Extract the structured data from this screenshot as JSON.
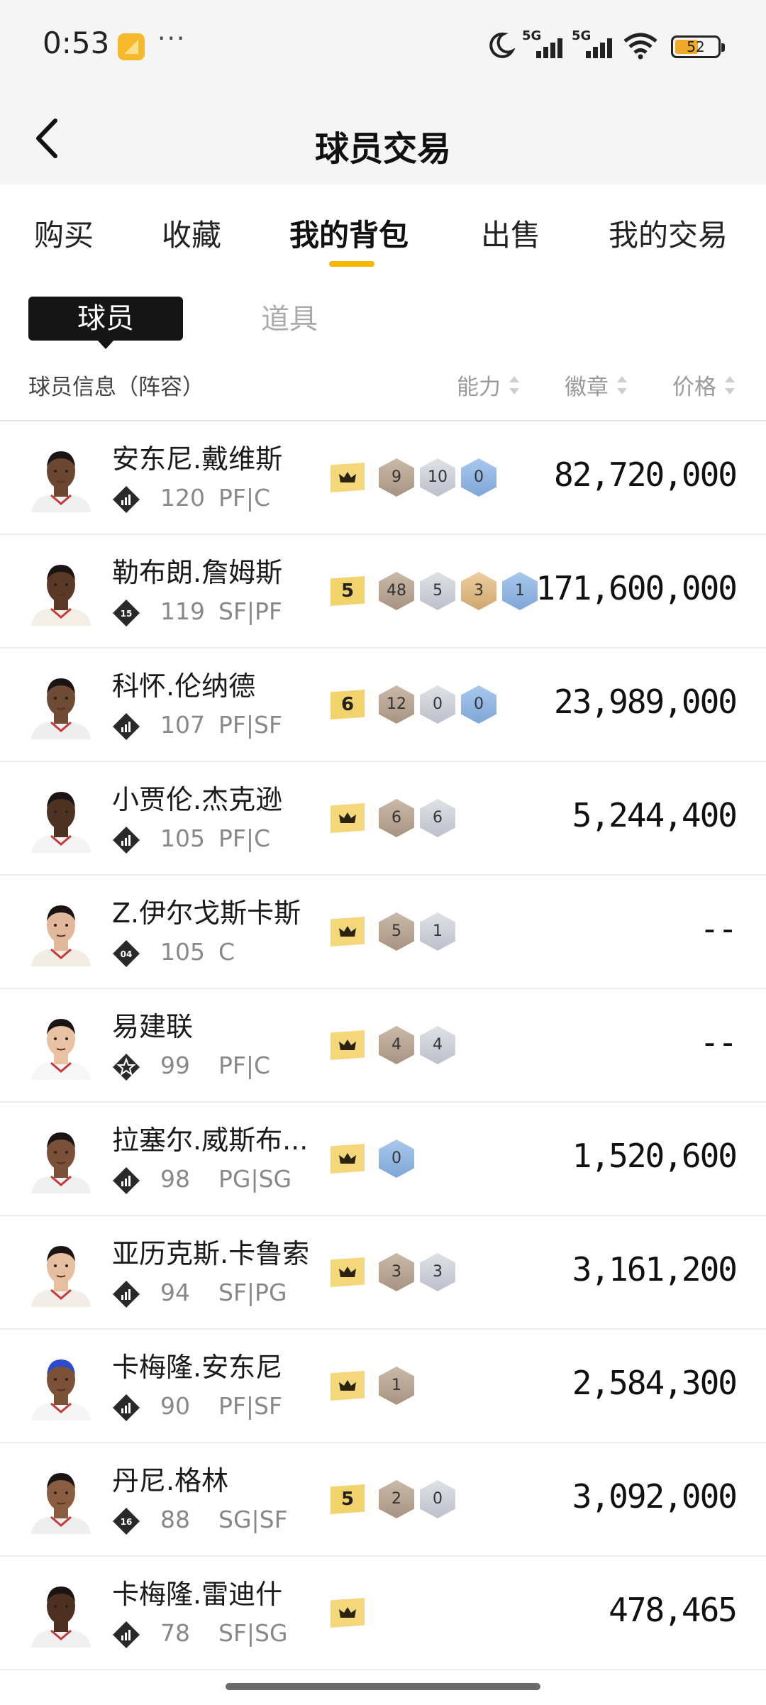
{
  "status_bar": {
    "time": "0:53",
    "more": "···",
    "battery": "52",
    "network_1": "5G",
    "network_2": "5G"
  },
  "nav": {
    "title": "球员交易"
  },
  "tabs": [
    {
      "label": "购买",
      "active": false
    },
    {
      "label": "收藏",
      "active": false
    },
    {
      "label": "我的背包",
      "active": true
    },
    {
      "label": "出售",
      "active": false
    },
    {
      "label": "我的交易",
      "active": false
    }
  ],
  "segments": {
    "active": "球员",
    "other": "道具"
  },
  "list_header": {
    "info": "球员信息（阵容）",
    "ability": "能力",
    "badge": "徽章",
    "price": "价格"
  },
  "players": [
    {
      "name": "安东尼.戴维斯",
      "ovr": "120",
      "pos": "PF|C",
      "level": "",
      "crown": "",
      "badges": [
        [
          "br",
          "9"
        ],
        [
          "sv",
          "10"
        ],
        [
          "bl",
          "0"
        ]
      ],
      "price": "82,720,000"
    },
    {
      "name": "勒布朗.詹姆斯",
      "ovr": "119",
      "pos": "SF|PF",
      "level": "15",
      "crown": "5",
      "badges": [
        [
          "br",
          "48"
        ],
        [
          "sv",
          "5"
        ],
        [
          "gd",
          "3"
        ],
        [
          "bl",
          "1"
        ]
      ],
      "price": "171,600,000"
    },
    {
      "name": "科怀.伦纳德",
      "ovr": "107",
      "pos": "PF|SF",
      "level": "",
      "crown": "6",
      "badges": [
        [
          "br",
          "12"
        ],
        [
          "sv",
          "0"
        ],
        [
          "bl",
          "0"
        ]
      ],
      "price": "23,989,000"
    },
    {
      "name": "小贾伦.杰克逊",
      "ovr": "105",
      "pos": "PF|C",
      "level": "",
      "crown": "",
      "badges": [
        [
          "br",
          "6"
        ],
        [
          "sv",
          "6"
        ]
      ],
      "price": "5,244,400"
    },
    {
      "name": "Z.伊尔戈斯卡斯",
      "ovr": "105",
      "pos": "C",
      "level": "04",
      "crown": "",
      "badges": [
        [
          "br",
          "5"
        ],
        [
          "sv",
          "1"
        ]
      ],
      "price": "--"
    },
    {
      "name": "易建联",
      "ovr": "99",
      "pos": "PF|C",
      "level": "star",
      "crown": "",
      "badges": [
        [
          "br",
          "4"
        ],
        [
          "sv",
          "4"
        ]
      ],
      "price": "--"
    },
    {
      "name": "拉塞尔.威斯布...",
      "ovr": "98",
      "pos": "PG|SG",
      "level": "",
      "crown": "",
      "badges": [
        [
          "bl",
          "0"
        ]
      ],
      "price": "1,520,600"
    },
    {
      "name": "亚历克斯.卡鲁索",
      "ovr": "94",
      "pos": "SF|PG",
      "level": "",
      "crown": "",
      "badges": [
        [
          "br",
          "3"
        ],
        [
          "sv",
          "3"
        ]
      ],
      "price": "3,161,200"
    },
    {
      "name": "卡梅隆.安东尼",
      "ovr": "90",
      "pos": "PF|SF",
      "level": "",
      "crown": "",
      "badges": [
        [
          "br",
          "1"
        ]
      ],
      "price": "2,584,300"
    },
    {
      "name": "丹尼.格林",
      "ovr": "88",
      "pos": "SG|SF",
      "level": "16",
      "crown": "5",
      "badges": [
        [
          "br",
          "2"
        ],
        [
          "sv",
          "0"
        ]
      ],
      "price": "3,092,000"
    },
    {
      "name": "卡梅隆.雷迪什",
      "ovr": "78",
      "pos": "SF|SG",
      "level": "",
      "crown": "",
      "badges": [],
      "price": "478,465"
    }
  ],
  "colors": {
    "accent": "#f5b800",
    "crown": "#f4d77a"
  }
}
